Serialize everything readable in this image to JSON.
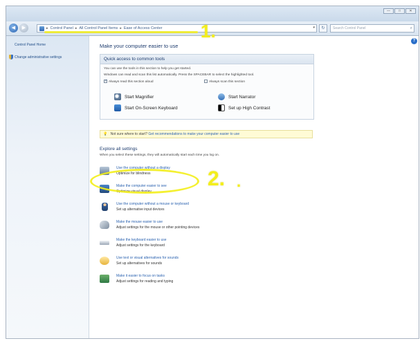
{
  "window": {
    "controls": [
      "—",
      "□",
      "✕"
    ]
  },
  "address_bar": {
    "breadcrumbs": [
      "Control Panel",
      "All Control Panel Items",
      "Ease of Access Center"
    ],
    "separator": "▸",
    "dropdown_glyph": "▾",
    "refresh_glyph": "↻",
    "search_placeholder": "Search Control Panel",
    "search_glyph": "⌕",
    "back_glyph": "◀",
    "forward_glyph": "▶"
  },
  "sidebar": {
    "items": [
      {
        "label": "Control Panel Home",
        "icon": "none"
      },
      {
        "label": "Change administrative settings",
        "icon": "uac-shield-icon"
      }
    ]
  },
  "main": {
    "help_glyph": "?",
    "heading": "Make your computer easier to use",
    "quick_access": {
      "title": "Quick access to common tools",
      "line1": "You can use the tools in this section to help you get started.",
      "line2": "Windows can read and scan this list automatically.  Press the SPACEBAR to select the highlighted tool.",
      "checkbox_read": {
        "label": "Always read this section aloud",
        "checked": true
      },
      "checkbox_scan": {
        "label": "Always scan this section",
        "checked": false
      },
      "tools": [
        {
          "label": "Start Magnifier",
          "icon": "magnifier-icon"
        },
        {
          "label": "Start Narrator",
          "icon": "narrator-icon"
        },
        {
          "label": "Start On-Screen Keyboard",
          "icon": "keyboard-icon"
        },
        {
          "label": "Set up High Contrast",
          "icon": "high-contrast-icon"
        }
      ]
    },
    "tip": {
      "glyph": "💡",
      "question": "Not sure where to start?",
      "link": "Get recommendations to make your computer easier to use"
    },
    "explore": {
      "title": "Explore all settings",
      "subtitle": "When you select these settings, they will automatically start each time you log on.",
      "settings": [
        {
          "link": "Use the computer without a display",
          "desc": "Optimize for blindness",
          "icon": "display-icon"
        },
        {
          "link": "Make the computer easier to see",
          "desc": "Optimize visual display",
          "icon": "visual-display-icon"
        },
        {
          "link": "Use the computer without a mouse or keyboard",
          "desc": "Set up alternative input devices",
          "icon": "person-icon"
        },
        {
          "link": "Make the mouse easier to use",
          "desc": "Adjust settings for the mouse or other pointing devices",
          "icon": "mouse-icon"
        },
        {
          "link": "Make the keyboard easier to use",
          "desc": "Adjust settings for the keyboard",
          "icon": "keyboard-icon"
        },
        {
          "link": "Use text or visual alternatives for sounds",
          "desc": "Set up alternatives for sounds",
          "icon": "sound-icon"
        },
        {
          "link": "Make it easier to focus on tasks",
          "desc": "Adjust settings for reading and typing",
          "icon": "reading-icon"
        }
      ]
    }
  },
  "annotations": {
    "label1": "1.",
    "label2": "2.",
    "dot": ".",
    "color": "#f3ee1c"
  }
}
